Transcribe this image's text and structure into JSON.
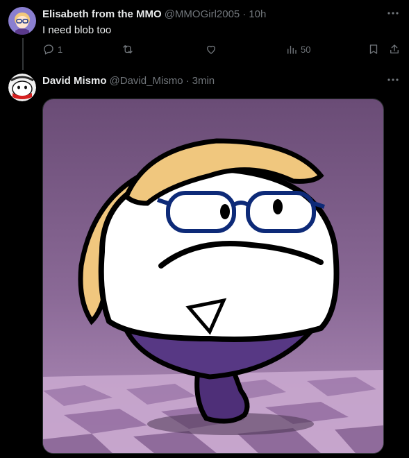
{
  "tweet1": {
    "display_name": "Elisabeth from the MMO",
    "handle": "@MMOGirl2005",
    "separator": "·",
    "time": "10h",
    "text": "I need blob too",
    "replies": "1",
    "retweets": "",
    "likes": "",
    "views": "50",
    "more_icon": "more-icon"
  },
  "tweet2": {
    "display_name": "David Mismo",
    "handle": "@David_Mismo",
    "separator": "·",
    "time": "3min",
    "media_description_icon": "image",
    "more_icon": "more-icon"
  },
  "colors": {
    "background": "#000000",
    "text_primary": "#e7e9ea",
    "text_secondary": "#71767b",
    "border": "#2f3336"
  }
}
